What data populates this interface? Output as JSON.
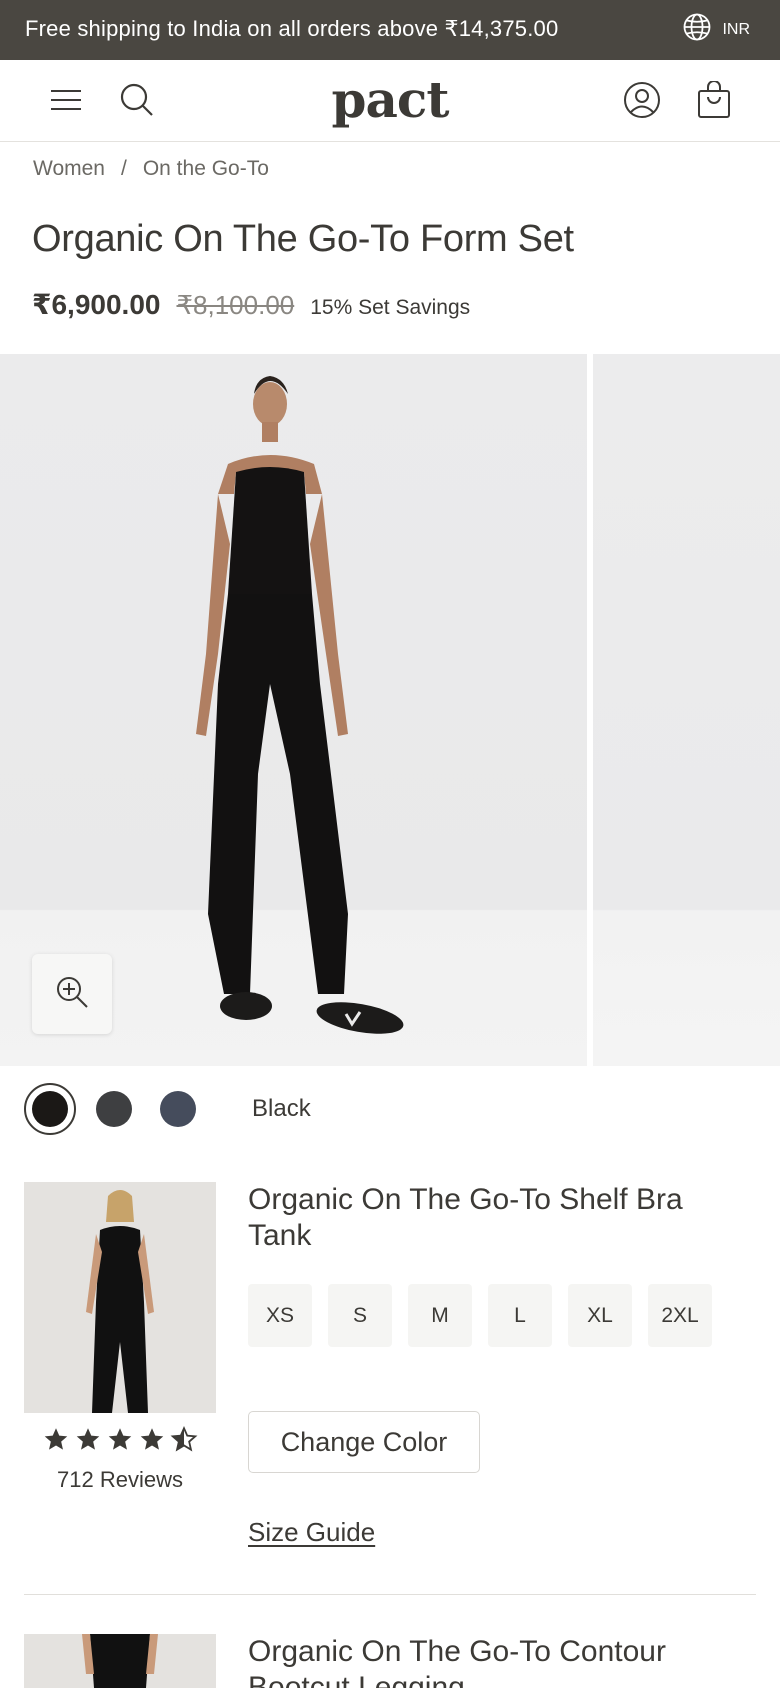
{
  "promo": {
    "text": "Free shipping to India on all orders above ₹14,375.00",
    "currency": "INR"
  },
  "header": {
    "logo": "pact",
    "icons": [
      "menu-icon",
      "search-icon",
      "account-icon",
      "bag-icon"
    ]
  },
  "breadcrumb": {
    "items": [
      "Women",
      "On the Go-To"
    ],
    "separator": "/"
  },
  "product": {
    "title": "Organic On The Go-To Form Set",
    "price": "₹6,900.00",
    "compare_price": "₹8,100.00",
    "savings": "15% Set Savings"
  },
  "gallery": {
    "zoom_icon": "zoom-in-icon"
  },
  "colors": {
    "selected_label": "Black",
    "swatches": [
      "#1b1816",
      "#3e3f41",
      "#454c5c"
    ]
  },
  "set_items": [
    {
      "name": "Organic On The Go-To Shelf Bra Tank",
      "sizes": [
        "XS",
        "S",
        "M",
        "L",
        "XL",
        "2XL"
      ],
      "change_color": "Change Color",
      "size_guide": "Size Guide",
      "rating": 4.5,
      "reviews": "712 Reviews"
    },
    {
      "name": "Organic On The Go-To Contour Bootcut Legging"
    }
  ],
  "colors_theme": {
    "promo_bg": "#4a4741",
    "text": "#3c3a36",
    "muted": "#6b6964"
  }
}
